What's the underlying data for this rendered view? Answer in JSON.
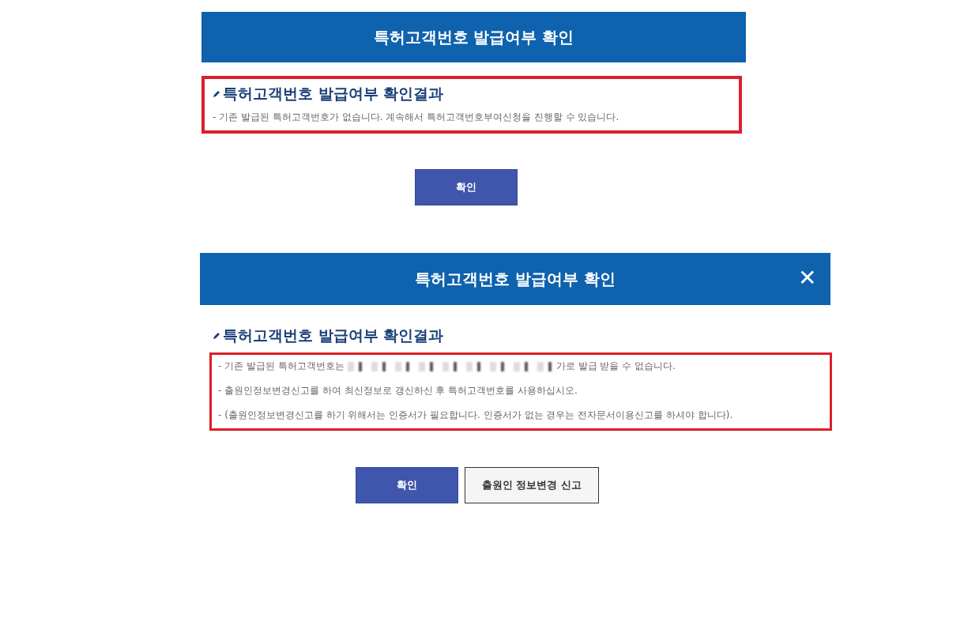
{
  "dialogs": [
    {
      "title": "특허고객번호 발급여부 확인",
      "result_title": "특허고객번호 발급여부 확인결과",
      "lines": [
        {
          "kind": "text",
          "text": "- 기존 발급된 특허고객번호가 없습니다. 계속해서 특허고객번호부여신청을 진행할 수 있습니다."
        }
      ],
      "buttons": [
        {
          "label": "확인",
          "kind": "primary"
        }
      ]
    },
    {
      "title": "특허고객번호 발급여부 확인",
      "close_label": "✕",
      "result_title": "특허고객번호 발급여부 확인결과",
      "lines": [
        {
          "kind": "redacted",
          "before": "- 기존 발급된 특허고객번호는",
          "after": "가로 발급 받을 수 없습니다."
        },
        {
          "kind": "text",
          "text": "- 출원인정보변경신고를 하여 최신정보로 갱신하신 후 특허고객번호를 사용하십시오."
        },
        {
          "kind": "text",
          "text": "- (출원인정보변경신고를 하기 위해서는 인증서가 필요합니다. 인증서가 없는 경우는 전자문서이용신고를 하셔야 합니다)."
        }
      ],
      "buttons": [
        {
          "label": "확인",
          "kind": "primary"
        },
        {
          "label": "출원인 정보변경 신고",
          "kind": "secondary"
        }
      ]
    }
  ]
}
